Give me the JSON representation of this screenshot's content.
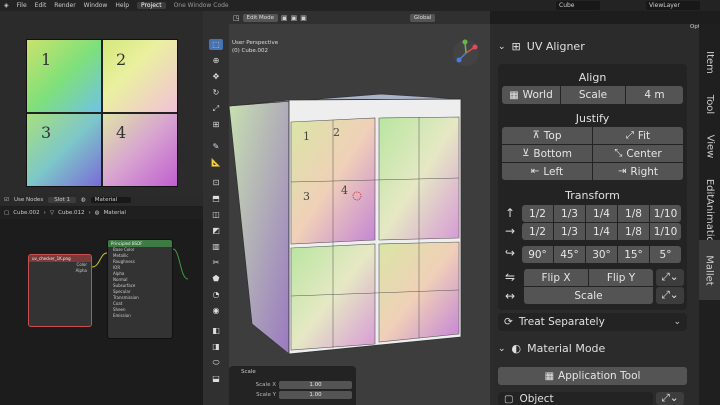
{
  "menu": {
    "items": [
      "File",
      "Edit",
      "Render",
      "Window",
      "Help"
    ],
    "workspace_active": "Project",
    "workspace_other": "One Window Code",
    "scene": "Cube",
    "view_layer": "ViewLayer"
  },
  "uv_editor": {
    "quadrant_labels": [
      "1",
      "2",
      "3",
      "4"
    ]
  },
  "node_editor": {
    "use_nodes": "Use Nodes",
    "slot": "Slot 1",
    "material": "Material",
    "breadcrumb": [
      "Cube.002",
      "Cube.012",
      "Material"
    ],
    "image_node": {
      "title": "uv_checker_1K.png",
      "rows": [
        "Color",
        "Alpha"
      ]
    },
    "bsdf_node": {
      "title": "Principled BSDF",
      "rows": [
        "Base Color",
        "Metallic",
        "Roughness",
        "IOR",
        "Alpha",
        "Normal",
        "Subsurface",
        "Specular",
        "Transmission",
        "Coat",
        "Sheen",
        "Emission"
      ]
    }
  },
  "viewport": {
    "mode": "Edit Mode",
    "transform": "Global",
    "info_line1": "User Perspective",
    "info_line2": "(0) Cube.002",
    "options": "Options"
  },
  "scale_panel": {
    "title": "Scale",
    "rows": [
      {
        "label": "Scale X",
        "value": "1.00"
      },
      {
        "label": "Scale Y",
        "value": "1.00"
      }
    ]
  },
  "npanel": {
    "title": "UV Aligner",
    "align": {
      "title": "Align",
      "world": "World",
      "scale": "Scale",
      "scale_value": "4 m"
    },
    "justify": {
      "title": "Justify",
      "items": [
        [
          "Top",
          "Fit"
        ],
        [
          "Bottom",
          "Center"
        ],
        [
          "Left",
          "Right"
        ]
      ]
    },
    "transform": {
      "title": "Transform",
      "fractions": [
        "1/2",
        "1/3",
        "1/4",
        "1/8",
        "1/10"
      ],
      "angles": [
        "90°",
        "45°",
        "30°",
        "15°",
        "5°"
      ],
      "flip_x": "Flip X",
      "flip_y": "Flip Y",
      "scale": "Scale"
    },
    "treat": "Treat Separately",
    "material_mode": "Material Mode",
    "application_tool": "Application Tool",
    "object": "Object"
  },
  "side_tabs": [
    "Item",
    "Tool",
    "View",
    "Edit",
    "Animation",
    "Mallet"
  ]
}
